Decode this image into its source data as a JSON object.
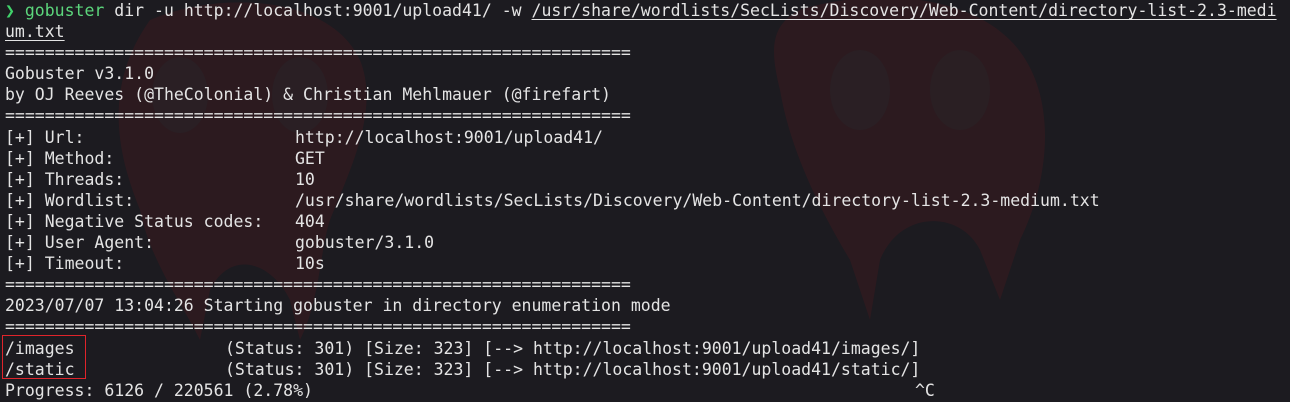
{
  "prompt": {
    "symbol": "❯",
    "command": "gobuster",
    "args": " dir -u http://localhost:9001/upload41/ -w ",
    "wordlist_part1": "/usr/share/wordlists/SecLists/Discovery/Web-Content/directory-list-2.3-medi",
    "wordlist_part2": "um.txt"
  },
  "separator": "===============================================================",
  "banner": {
    "version": "Gobuster v3.1.0",
    "authors": "by OJ Reeves (@TheColonial) & Christian Mehlmauer (@firefart)"
  },
  "config": [
    {
      "label": "[+] Url:",
      "value": "http://localhost:9001/upload41/"
    },
    {
      "label": "[+] Method:",
      "value": "GET"
    },
    {
      "label": "[+] Threads:",
      "value": "10"
    },
    {
      "label": "[+] Wordlist:",
      "value": "/usr/share/wordlists/SecLists/Discovery/Web-Content/directory-list-2.3-medium.txt"
    },
    {
      "label": "[+] Negative Status codes:",
      "value": "404"
    },
    {
      "label": "[+] User Agent:",
      "value": "gobuster/3.1.0"
    },
    {
      "label": "[+] Timeout:",
      "value": "10s"
    }
  ],
  "start_message": "2023/07/07 13:04:26 Starting gobuster in directory enumeration mode",
  "results": [
    {
      "path": "/images",
      "detail": "(Status: 301) [Size: 323] [--> http://localhost:9001/upload41/images/]"
    },
    {
      "path": "/static",
      "detail": "(Status: 301) [Size: 323] [--> http://localhost:9001/upload41/static/]"
    }
  ],
  "progress": "Progress: 6126 / 220561 (2.78%)",
  "interrupt": "^C",
  "colors": {
    "background": "#1c1b20",
    "prompt_green": "#41d26b",
    "highlight_red": "#e0242b"
  }
}
